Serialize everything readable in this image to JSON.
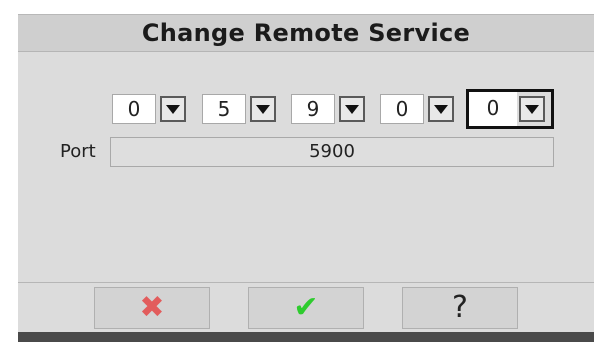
{
  "window": {
    "title": "Change Remote Service"
  },
  "digits": [
    "0",
    "5",
    "9",
    "0",
    "0"
  ],
  "port": {
    "label": "Port",
    "value": "5900"
  },
  "buttons": {
    "cancel_glyph": "✖",
    "ok_glyph": "✔",
    "help_glyph": "?"
  },
  "colors": {
    "cancel": "#e25c5c",
    "ok": "#2ecc2e"
  }
}
